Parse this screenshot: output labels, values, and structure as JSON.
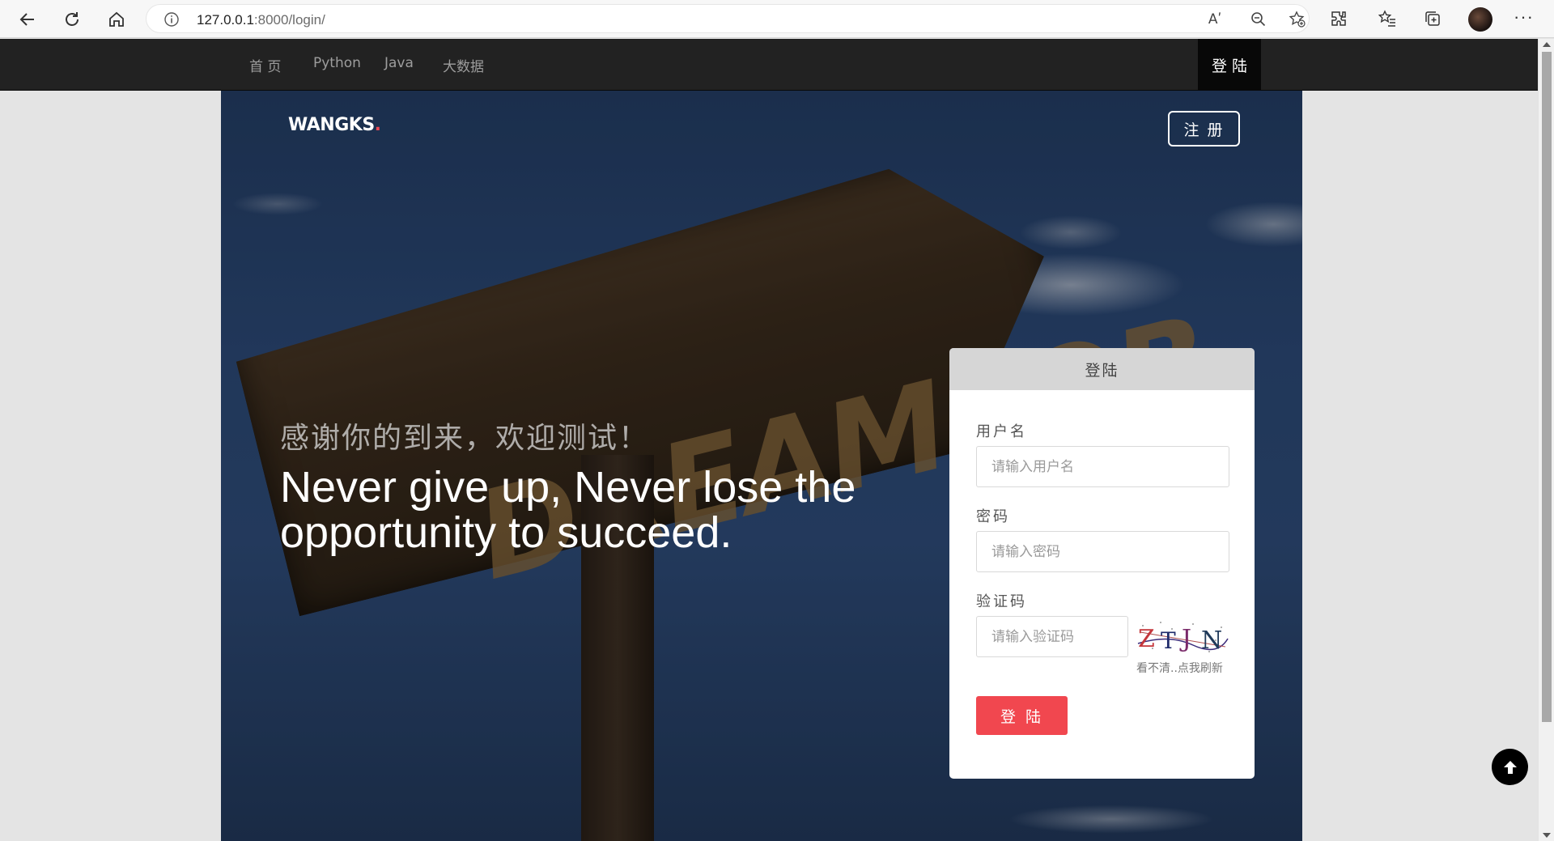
{
  "browser": {
    "url_host": "127.0.0.1",
    "url_path": ":8000/login/",
    "icons": [
      "back-icon",
      "refresh-icon",
      "home-icon",
      "info-icon",
      "read-aloud-icon",
      "zoom-out-icon",
      "add-favorite-icon",
      "extensions-icon",
      "favorites-icon",
      "collections-icon",
      "profile-avatar",
      "more-icon"
    ],
    "read_aloud_glyph": "Aʹ",
    "more_glyph": "···"
  },
  "nav": {
    "items": [
      "首 页",
      "Python",
      "Java",
      "大数据"
    ],
    "login_label": "登 陆"
  },
  "hero": {
    "brand": "WANGKS",
    "brand_dot": ".",
    "register_label": "注 册",
    "greeting": "感谢你的到来，欢迎测试！",
    "slogan": "Never give up, Never lose the opportunity to succeed.",
    "sign_text": "DREAM JOB"
  },
  "login": {
    "title": "登陆",
    "username_label": "用户名",
    "username_placeholder": "请输入用户名",
    "password_label": "密码",
    "password_placeholder": "请输入密码",
    "captcha_label": "验证码",
    "captcha_placeholder": "请输入验证码",
    "captcha_text": "ZTJN",
    "captcha_hint": "看不清..点我刷新",
    "submit_label": "登 陆"
  },
  "colors": {
    "accent": "#f1474f",
    "nav_bg": "#222222",
    "nav_active_bg": "#080808"
  }
}
